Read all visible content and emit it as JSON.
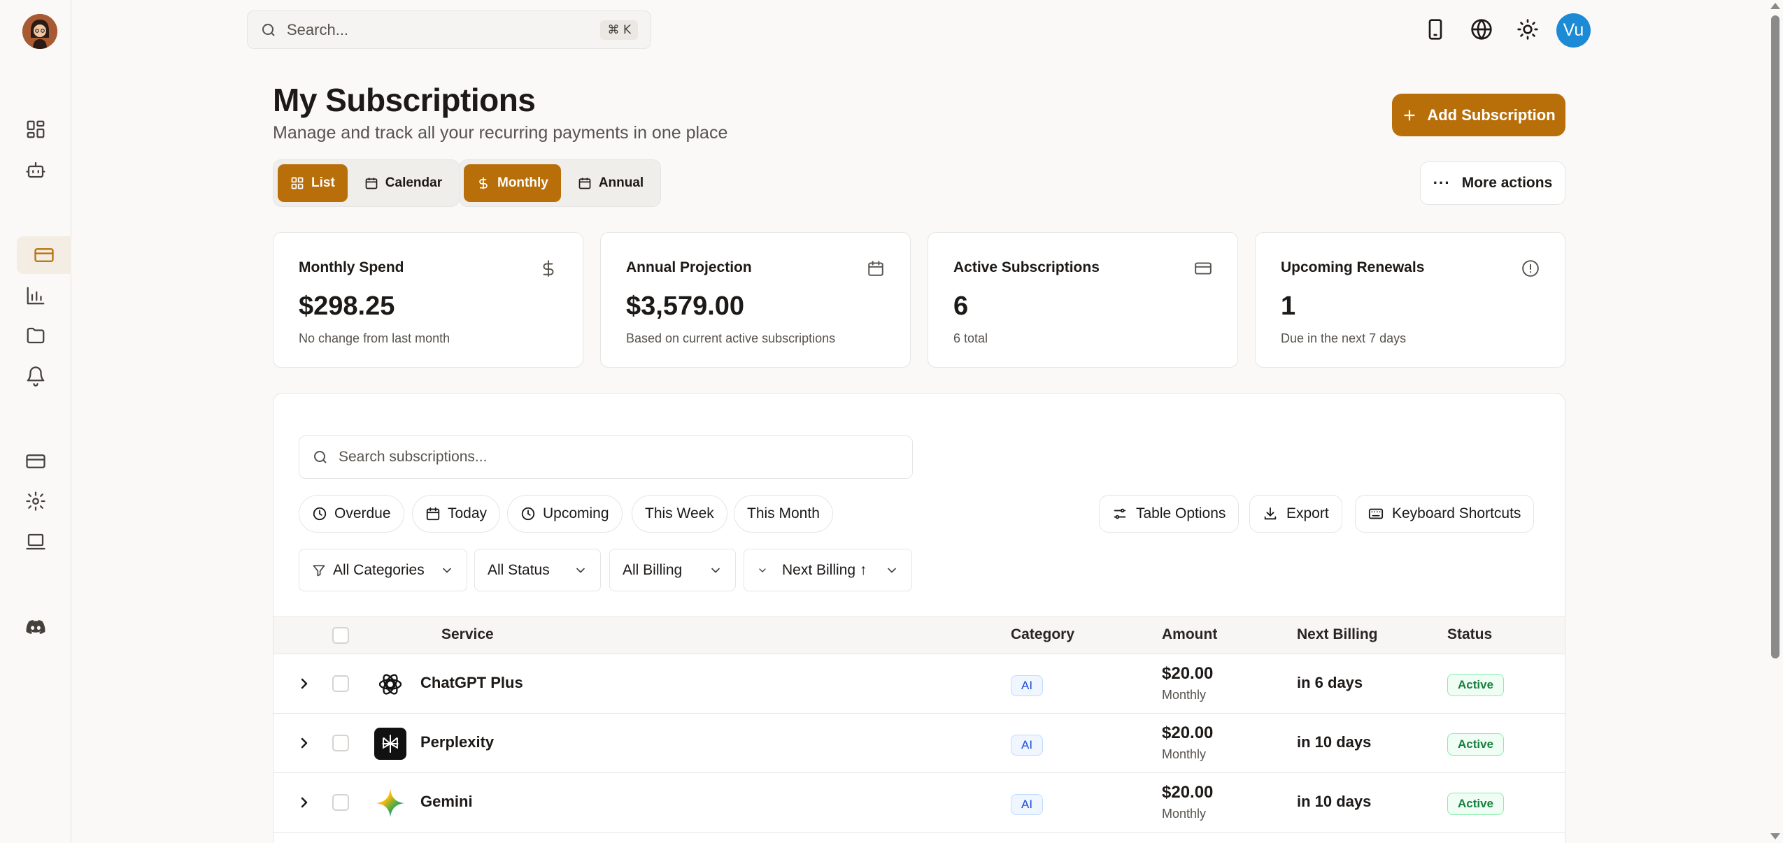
{
  "topbar": {
    "search_placeholder": "Search...",
    "search_shortcut": "⌘ K",
    "user_initials": "Vu"
  },
  "header": {
    "title": "My Subscriptions",
    "subtitle": "Manage and track all your recurring payments in one place",
    "add_button": "Add Subscription",
    "more_actions": "More actions"
  },
  "view_toggle": {
    "list": "List",
    "calendar": "Calendar",
    "selected": "List"
  },
  "period_toggle": {
    "monthly": "Monthly",
    "annual": "Annual",
    "selected": "Monthly"
  },
  "stats": [
    {
      "label": "Monthly Spend",
      "value": "$298.25",
      "note": "No change from last month",
      "icon": "dollar-icon"
    },
    {
      "label": "Annual Projection",
      "value": "$3,579.00",
      "note": "Based on current active subscriptions",
      "icon": "calendar-icon"
    },
    {
      "label": "Active Subscriptions",
      "value": "6",
      "note": "6 total",
      "icon": "credit-card-icon"
    },
    {
      "label": "Upcoming Renewals",
      "value": "1",
      "note": "Due in the next 7 days",
      "icon": "alert-circle-icon"
    }
  ],
  "table_search_placeholder": "Search subscriptions...",
  "quick_filters": [
    "Overdue",
    "Today",
    "Upcoming",
    "This Week",
    "This Month"
  ],
  "table_actions": {
    "options": "Table Options",
    "export": "Export",
    "shortcuts": "Keyboard Shortcuts"
  },
  "dropdowns": {
    "categories": "All Categories",
    "status": "All Status",
    "billing": "All Billing",
    "sort": "Next Billing ↑"
  },
  "columns": {
    "service": "Service",
    "category": "Category",
    "amount": "Amount",
    "next_billing": "Next Billing",
    "status": "Status"
  },
  "rows": [
    {
      "service": "ChatGPT Plus",
      "category": "AI",
      "amount": "$20.00",
      "period": "Monthly",
      "next_billing": "in 6 days",
      "status": "Active"
    },
    {
      "service": "Perplexity",
      "category": "AI",
      "amount": "$20.00",
      "period": "Monthly",
      "next_billing": "in 10 days",
      "status": "Active"
    },
    {
      "service": "Gemini",
      "category": "AI",
      "amount": "$20.00",
      "period": "Monthly",
      "next_billing": "in 10 days",
      "status": "Active"
    }
  ],
  "colors": {
    "accent": "#b86f0a",
    "avatar": "#1d8ad6",
    "status_active": "#15803d",
    "category": "#1d4ed8"
  }
}
